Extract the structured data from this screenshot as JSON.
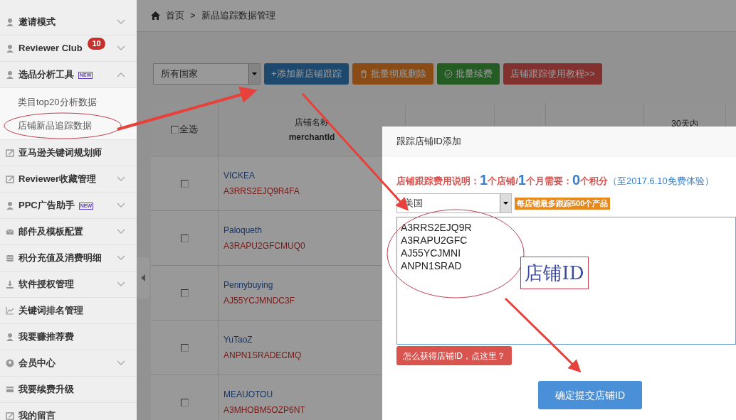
{
  "sidebar": {
    "items": [
      {
        "label": "邀请模式",
        "expanded": false
      },
      {
        "label": "Reviewer Club",
        "badge": "10",
        "expanded": false
      },
      {
        "label": "选品分析工具",
        "tag": "NEW",
        "expanded": true,
        "children": [
          {
            "label": "类目top20分析数据"
          },
          {
            "label": "店铺新品追踪数据"
          }
        ]
      },
      {
        "label": "亚马逊关键词规划师"
      },
      {
        "label": "Reviewer收藏管理",
        "expanded": false
      },
      {
        "label": "PPC广告助手",
        "tag": "NEW",
        "expanded": false
      },
      {
        "label": "邮件及模板配置",
        "expanded": false
      },
      {
        "label": "积分充值及消费明细",
        "expanded": false
      },
      {
        "label": "软件授权管理",
        "expanded": false
      },
      {
        "label": "关键词排名管理"
      },
      {
        "label": "我要赚推荐费"
      },
      {
        "label": "会员中心",
        "expanded": false
      },
      {
        "label": "我要续费升级"
      },
      {
        "label": "我的留言"
      }
    ]
  },
  "breadcrumb": [
    "首页",
    ">",
    "新品追踪数据管理"
  ],
  "toolbar": {
    "country_select": "所有国家",
    "buttons": [
      {
        "label": "+添加新店铺跟踪",
        "kind": "add"
      },
      {
        "label": "批量彻底删除",
        "kind": "delete"
      },
      {
        "label": "批量续费",
        "kind": "renew"
      },
      {
        "label": "店铺跟踪使用教程>>",
        "kind": "tutorial"
      }
    ]
  },
  "table": {
    "columns": [
      {
        "kind": "checkbox",
        "label": "全选",
        "checked": false
      },
      {
        "kind": "text",
        "label": "店铺名称",
        "sublabel": "merchantId"
      },
      {
        "kind": "blank"
      },
      {
        "kind": "blank"
      },
      {
        "kind": "blank"
      },
      {
        "kind": "text",
        "label": "30天内"
      }
    ],
    "rows": [
      {
        "name": "VICKEA",
        "merchant_id": "A3RRS2EJQ9R4FA",
        "checked": false
      },
      {
        "name": "Paloqueth",
        "merchant_id": "A3RAPU2GFCMUQ0",
        "checked": false
      },
      {
        "name": "Pennybuying",
        "merchant_id": "AJ55YCJMNDC3F",
        "checked": false
      },
      {
        "name": "YuTaoZ",
        "merchant_id": "ANPN1SRADECMQ",
        "checked": false
      },
      {
        "name": "MEAUOTOU",
        "merchant_id": "A3MHOBM5OZP6NT",
        "checked": false
      }
    ]
  },
  "dialog": {
    "title": "跟踪店铺ID添加",
    "fee_note": [
      {
        "text": "店铺跟踪费用说明：",
        "kind": "label"
      },
      {
        "text": "1",
        "kind": "number"
      },
      {
        "text": "个店铺/",
        "kind": "label"
      },
      {
        "text": "1",
        "kind": "number"
      },
      {
        "text": "个月需要：",
        "kind": "label"
      },
      {
        "text": "0",
        "kind": "number"
      },
      {
        "text": "个积分",
        "kind": "label"
      },
      {
        "text": "（至2017.6.10免费体验）",
        "kind": "note"
      }
    ],
    "country_select": "美国",
    "limit_badge": "每店铺最多跟踪500个产品",
    "ids": [
      "A3RRS2EJQ9R",
      "A3RAPU2GFC",
      "AJ55YCJMNI",
      "ANPN1SRAD"
    ],
    "help_button": "怎么获得店铺ID，点这里？",
    "submit_button": "确定提交店铺ID"
  },
  "annotation": {
    "label": "店铺ID"
  }
}
